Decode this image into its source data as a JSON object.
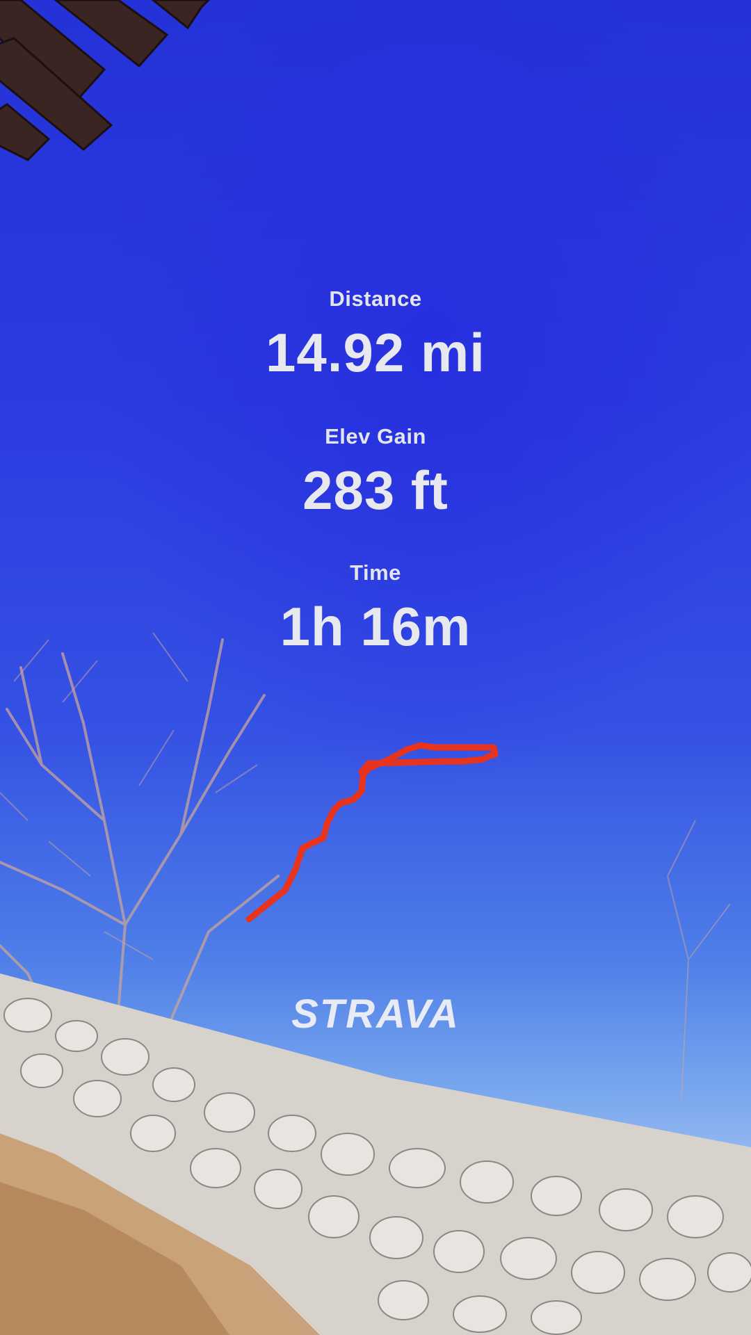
{
  "stats": [
    {
      "label": "Distance",
      "value": "14.92 mi"
    },
    {
      "label": "Elev Gain",
      "value": "283 ft"
    },
    {
      "label": "Time",
      "value": "1h 16m"
    }
  ],
  "route": {
    "color": "#e8341c"
  },
  "brand": {
    "name": "STRAVA"
  },
  "colors": {
    "sky": "#2a36d6",
    "text": "#e8e8ef",
    "route": "#e8341c"
  }
}
